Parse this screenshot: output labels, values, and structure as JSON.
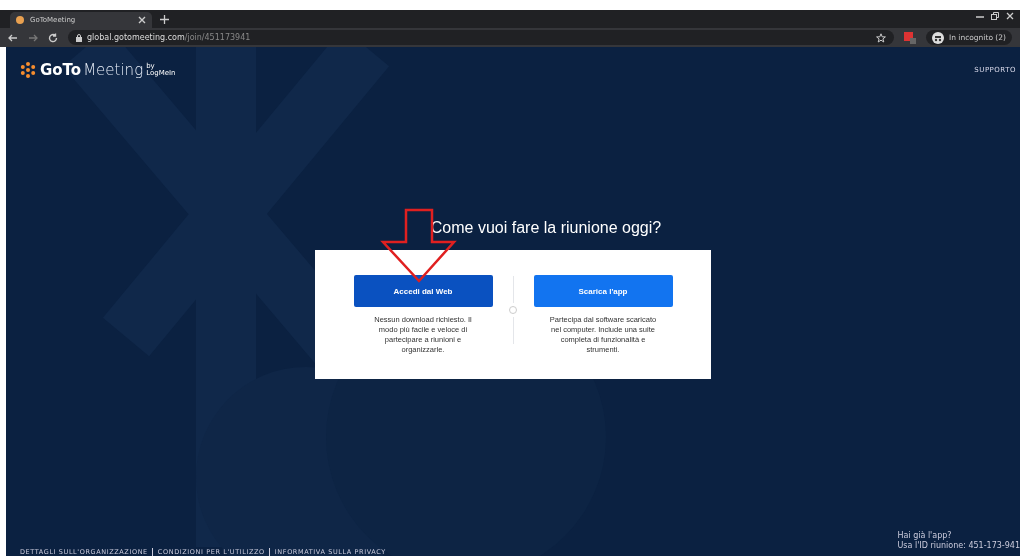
{
  "browser": {
    "tab": {
      "title": "GoToMeeting",
      "selected": true
    },
    "url": {
      "host": "global.gotomeeting.com",
      "path": "/join/451173941"
    },
    "profile": "In incognito (2)"
  },
  "header": {
    "logo": {
      "bold": "GoTo",
      "light": "Meeting",
      "by": "by",
      "company": "LogMeIn"
    },
    "support": "SUPPORTO"
  },
  "title": "Come vuoi fare la riunione oggi?",
  "options": [
    {
      "button": "Accedi dal Web",
      "kind": "primary",
      "description": "Nessun download richiesto. Il modo più facile e veloce di partecipare a riunioni e organizzarle."
    },
    {
      "button": "Scarica l'app",
      "kind": "secondary",
      "description": "Partecipa dal software scaricato nel computer. Include una suite completa di funzionalità e strumenti."
    }
  ],
  "footer_links": [
    "DETTAGLI SULL'ORGANIZZAZIONE",
    "CONDIZIONI PER L'UTILIZZO",
    "INFORMATIVA SULLA PRIVACY"
  ],
  "app_hint": {
    "question": "Hai già l'app?",
    "meeting_id": "Usa l'ID riunione: 451-173-941"
  }
}
